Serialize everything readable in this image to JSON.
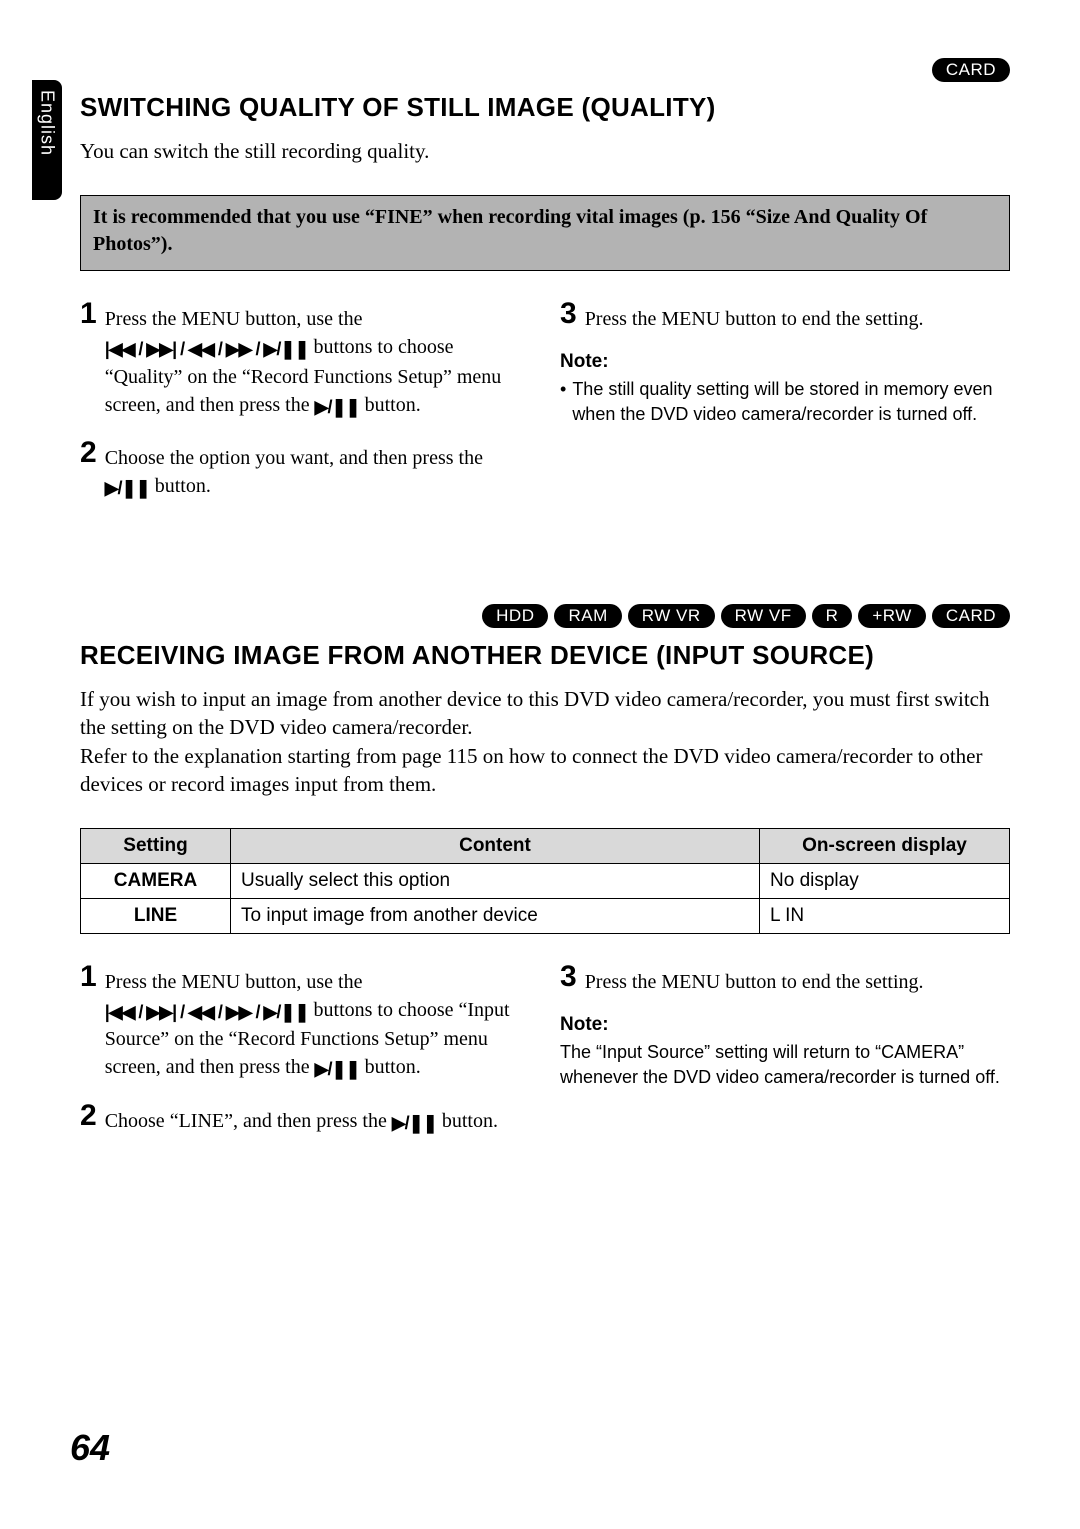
{
  "lang_tab": "English",
  "section1": {
    "badges": [
      "CARD"
    ],
    "title": "SWITCHING QUALITY OF STILL IMAGE (QUALITY)",
    "intro": "You can switch the still recording quality.",
    "recommend": "It is recommended that you use “FINE” when recording vital images (p. 156 “Size And Quality Of Photos”).",
    "step1a": "Press the MENU button, use the ",
    "step1b": " buttons to choose “Quality” on the “Record Functions Setup” menu screen, and then press the ",
    "step1c": " button.",
    "step2a": "Choose the option you want, and then press the ",
    "step2b": " button.",
    "step3": "Press the MENU button to end the setting.",
    "note_label": "Note:",
    "note_bullet": "•",
    "note_text": "The still quality setting will be stored in memory even when the DVD video camera/recorder is turned off."
  },
  "section2": {
    "badges": [
      "HDD",
      "RAM",
      "RW VR",
      "RW VF",
      "R",
      "+RW",
      "CARD"
    ],
    "title": "RECEIVING IMAGE FROM ANOTHER DEVICE (INPUT SOURCE)",
    "intro": "If you wish to input an image from another device to this DVD video camera/recorder, you must first switch the setting on the DVD video camera/recorder.\nRefer to the explanation starting from page 115 on how to connect the DVD video camera/recorder to other devices or record images input from them.",
    "table": {
      "headers": [
        "Setting",
        "Content",
        "On-screen display"
      ],
      "rows": [
        {
          "setting": "CAMERA",
          "content": "Usually select this option",
          "display": "No display"
        },
        {
          "setting": "LINE",
          "content": "To input image from another device",
          "display": "L IN"
        }
      ]
    },
    "step1a": "Press the MENU button, use the ",
    "step1b": " buttons to choose “Input Source” on the “Record Functions Setup” menu screen, and then press the ",
    "step1c": " button.",
    "step2a": "Choose “LINE”, and then press the ",
    "step2b": " button.",
    "step3": "Press the MENU button to end the setting.",
    "note_label": "Note:",
    "note_text": "The “Input Source” setting will return to “CAMERA” whenever the DVD video camera/recorder is turned off."
  },
  "icons": {
    "prev_next": "|◀◀ / ▶▶| / ◀◀ / ▶▶ / ▶/❚❚",
    "play_pause": "▶/❚❚"
  },
  "page_number": "64"
}
